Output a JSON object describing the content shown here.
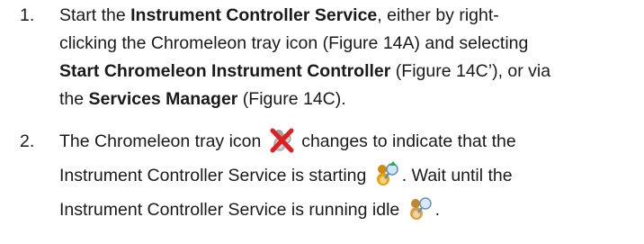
{
  "steps": [
    {
      "number": "1.",
      "lines": [
        {
          "a": "Start the ",
          "b1": "Instrument Controller Service",
          "c": ", either by right-"
        },
        {
          "a": "clicking the Chromeleon tray icon (Figure 14A) and selecting"
        },
        {
          "b1": "Start Chromeleon Instrument Controller",
          "c": " (Figure 14C’), or via"
        },
        {
          "a": "the ",
          "b1": "Services Manager",
          "c": " (Figure 14C)."
        }
      ]
    },
    {
      "number": "2.",
      "lines": [
        {
          "a": "The Chromeleon tray icon ",
          "c": " changes to indicate that the"
        },
        {
          "a": "Instrument Controller Service is starting ",
          "c": ". Wait until the"
        },
        {
          "a": "Instrument Controller Service is running idle ",
          "c": "."
        }
      ]
    }
  ],
  "icons": {
    "stopped": "tray-icon-stopped",
    "starting": "tray-icon-starting",
    "idle": "tray-icon-idle"
  }
}
